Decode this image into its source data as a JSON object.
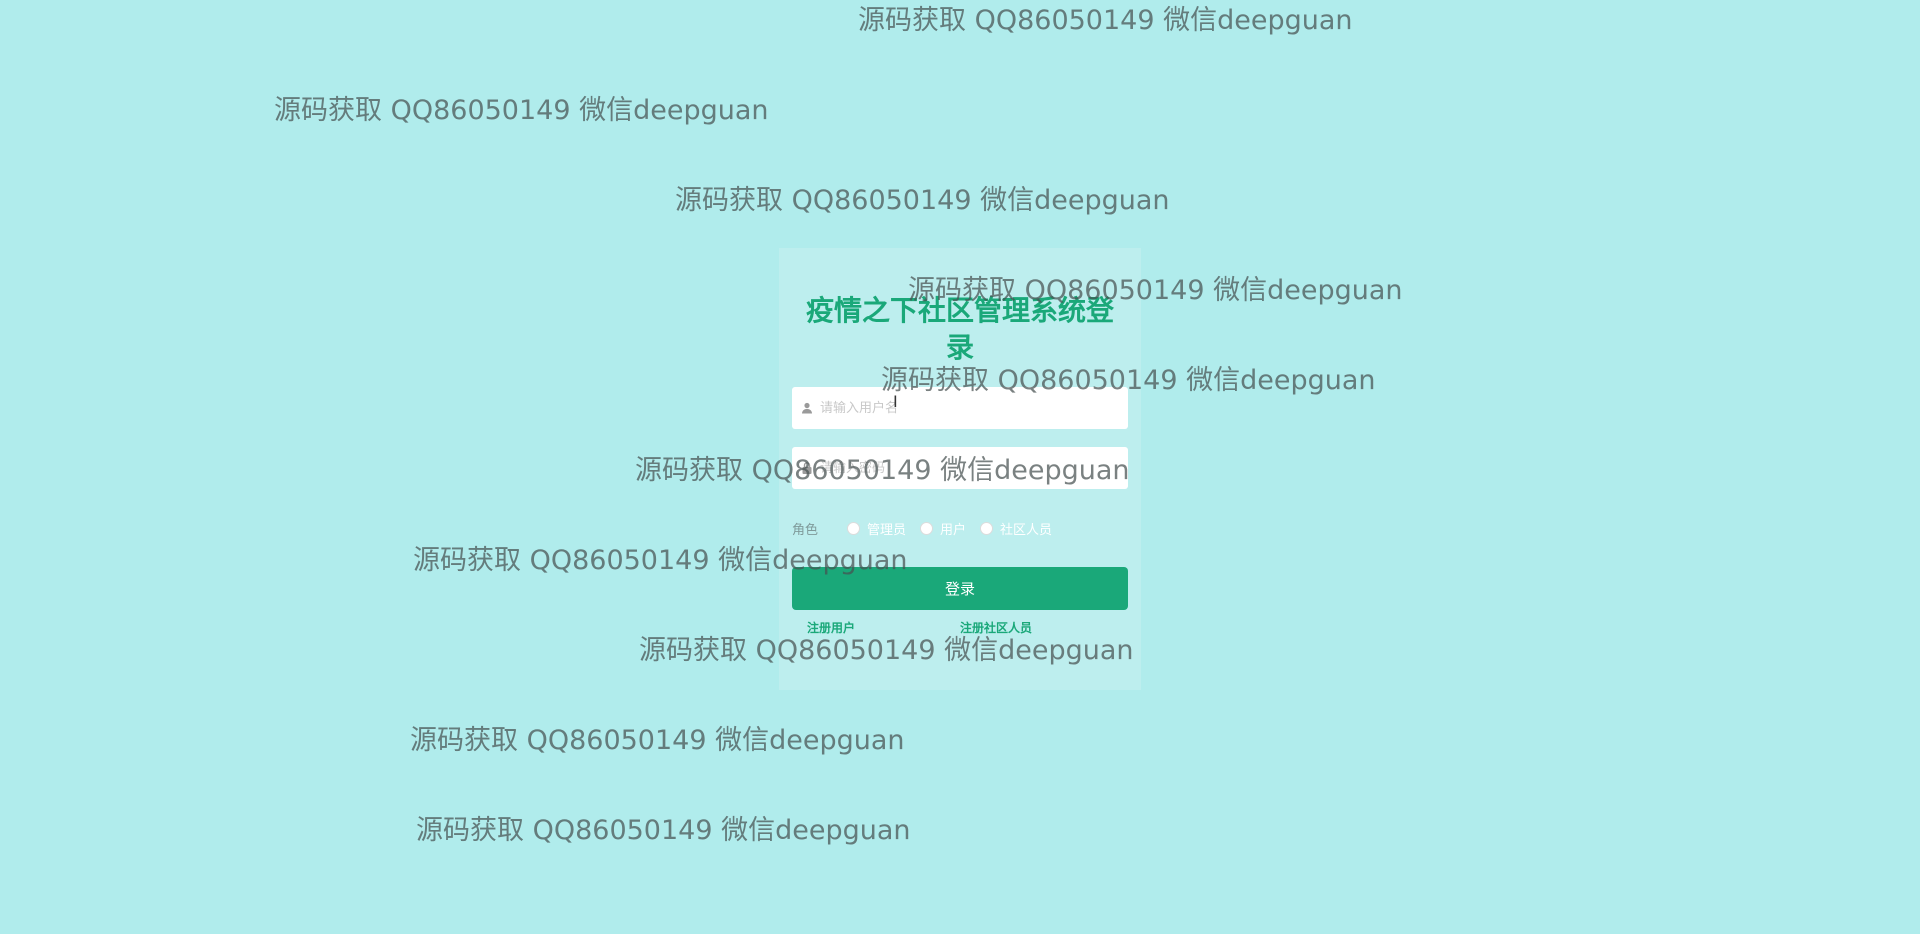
{
  "login": {
    "title": "疫情之下社区管理系统登录",
    "username_placeholder": "请输入用户名",
    "password_placeholder": "请输入密码",
    "role_label": "角色",
    "roles": [
      "管理员",
      "用户",
      "社区人员"
    ],
    "login_button": "登录",
    "register_user": "注册用户",
    "register_staff": "注册社区人员"
  },
  "watermark_text": "源码获取 QQ86050149 微信deepguan",
  "icons": {
    "username": "user-icon",
    "password": "lock-icon"
  },
  "colors": {
    "background": "#b0ecec",
    "accent": "#1aa879"
  }
}
